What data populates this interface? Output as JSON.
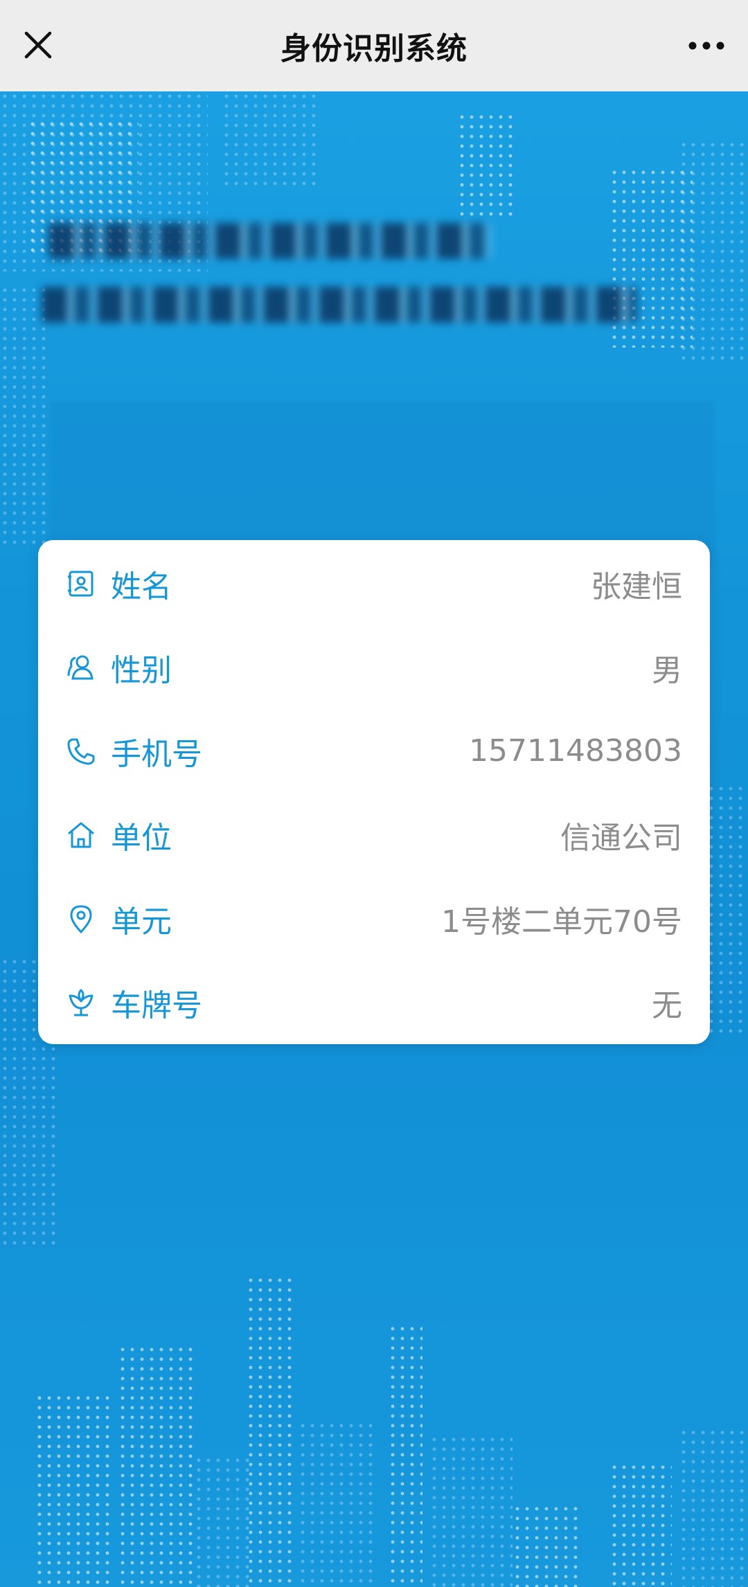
{
  "header": {
    "title": "身份识别系统",
    "close_icon": "close-icon",
    "more_icon": "more-icon"
  },
  "info": {
    "rows": [
      {
        "label": "姓名",
        "value": "张建恒",
        "icon": "id-card-icon"
      },
      {
        "label": "性别",
        "value": "男",
        "icon": "people-icon"
      },
      {
        "label": "手机号",
        "value": "15711483803",
        "icon": "phone-icon"
      },
      {
        "label": "单位",
        "value": "信通公司",
        "icon": "home-icon"
      },
      {
        "label": "单元",
        "value": "1号楼二单元70号",
        "icon": "location-icon"
      },
      {
        "label": "车牌号",
        "value": "无",
        "icon": "flower-icon"
      }
    ]
  },
  "colors": {
    "accent": "#1596d6",
    "background": "#1597db",
    "titlebar": "#ededed",
    "value_text": "#8c8c8c"
  }
}
